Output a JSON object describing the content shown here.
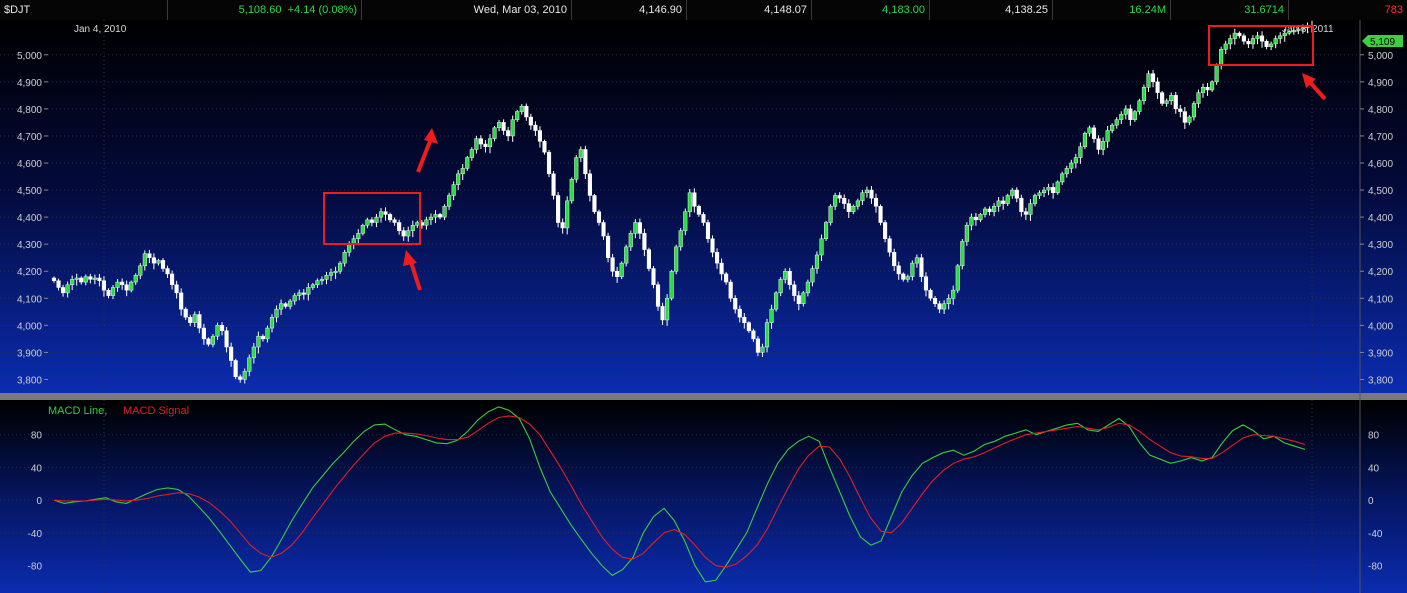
{
  "header": {
    "symbol": "$DJT",
    "last": "5,108.60",
    "change": "+4.14 (0.08%)",
    "date": "Wed, Mar 03, 2010",
    "open": "4,146.90",
    "close_prev": "4,148.07",
    "high": "4,183.00",
    "low": "4,138.25",
    "volume": "16.24M",
    "stat": "31.6714",
    "stat2": "783"
  },
  "price_panel": {
    "start_date": "Jan 4, 2010",
    "end_date": "Jan 3, 2011",
    "last_price_tag": "5,109"
  },
  "macd_panel": {
    "line_label": "MACD Line,",
    "signal_label": "MACD Signal"
  },
  "colors": {
    "up_candle": "#2fd84a",
    "down_candle": "#ffffff",
    "macd_line": "#3ccc3c",
    "macd_signal": "#e02020",
    "annotation": "#ee1c1c",
    "background_top": "#000000",
    "background_bottom": "#0a2cb0"
  },
  "chart_data": [
    {
      "type": "candlestick",
      "title": "$DJT",
      "ylim": [
        3750,
        5110
      ],
      "y_ticks": [
        3800,
        3900,
        4000,
        4100,
        4200,
        4300,
        4400,
        4500,
        4600,
        4700,
        4800,
        4900,
        5000
      ],
      "y_tick_labels": [
        "3,800",
        "3,900",
        "4,000",
        "4,100",
        "4,200",
        "4,300",
        "4,400",
        "4,500",
        "4,600",
        "4,700",
        "4,800",
        "4,900",
        "5,000"
      ],
      "x_range": [
        "Jan 4, 2010",
        "Jan 3, 2011"
      ],
      "closes": [
        4165,
        4140,
        4120,
        4150,
        4170,
        4175,
        4160,
        4180,
        4170,
        4175,
        4165,
        4130,
        4110,
        4140,
        4160,
        4150,
        4130,
        4160,
        4185,
        4220,
        4265,
        4250,
        4230,
        4240,
        4210,
        4190,
        4150,
        4120,
        4060,
        4030,
        4010,
        4040,
        3990,
        3950,
        3930,
        3960,
        4000,
        3980,
        3920,
        3870,
        3810,
        3800,
        3830,
        3880,
        3920,
        3960,
        3950,
        3990,
        4030,
        4060,
        4080,
        4070,
        4090,
        4110,
        4120,
        4115,
        4140,
        4150,
        4165,
        4170,
        4185,
        4195,
        4200,
        4230,
        4270,
        4300,
        4320,
        4340,
        4370,
        4390,
        4380,
        4400,
        4420,
        4410,
        4390,
        4380,
        4350,
        4330,
        4350,
        4370,
        4380,
        4370,
        4390,
        4400,
        4410,
        4400,
        4440,
        4480,
        4520,
        4560,
        4580,
        4620,
        4650,
        4690,
        4670,
        4660,
        4690,
        4730,
        4750,
        4720,
        4700,
        4760,
        4790,
        4810,
        4770,
        4740,
        4720,
        4680,
        4640,
        4560,
        4480,
        4380,
        4360,
        4460,
        4540,
        4620,
        4650,
        4560,
        4480,
        4420,
        4380,
        4330,
        4250,
        4200,
        4180,
        4230,
        4290,
        4340,
        4380,
        4340,
        4280,
        4210,
        4150,
        4070,
        4020,
        4100,
        4200,
        4290,
        4350,
        4420,
        4490,
        4440,
        4410,
        4380,
        4320,
        4270,
        4230,
        4190,
        4160,
        4100,
        4060,
        4030,
        4010,
        3980,
        3950,
        3900,
        3920,
        4010,
        4060,
        4120,
        4170,
        4200,
        4150,
        4110,
        4080,
        4120,
        4160,
        4210,
        4260,
        4320,
        4380,
        4440,
        4480,
        4470,
        4450,
        4420,
        4440,
        4460,
        4490,
        4500,
        4470,
        4440,
        4380,
        4320,
        4270,
        4220,
        4190,
        4170,
        4180,
        4230,
        4250,
        4180,
        4130,
        4100,
        4080,
        4060,
        4080,
        4100,
        4130,
        4220,
        4310,
        4370,
        4400,
        4390,
        4410,
        4430,
        4420,
        4440,
        4460,
        4450,
        4480,
        4500,
        4470,
        4420,
        4410,
        4450,
        4480,
        4490,
        4500,
        4510,
        4490,
        4530,
        4560,
        4580,
        4600,
        4620,
        4660,
        4710,
        4730,
        4690,
        4650,
        4680,
        4720,
        4740,
        4760,
        4780,
        4800,
        4760,
        4790,
        4830,
        4880,
        4930,
        4900,
        4860,
        4820,
        4830,
        4850,
        4800,
        4790,
        4750,
        4770,
        4820,
        4860,
        4880,
        4870,
        4900,
        4960,
        5020,
        5040,
        5060,
        5080,
        5070,
        5050,
        5040,
        5060,
        5070,
        5050,
        5030,
        5040,
        5060,
        5070,
        5080,
        5085,
        5090,
        5095,
        5100,
        5105,
        5109
      ]
    },
    {
      "type": "line",
      "title": "MACD",
      "ylim": [
        -105,
        120
      ],
      "y_ticks": [
        -80,
        -40,
        0,
        40,
        80
      ],
      "y_tick_labels": [
        "-80",
        "-40",
        "0",
        "40",
        "80"
      ],
      "series": [
        {
          "name": "MACD Line",
          "values": [
            0,
            -4,
            -2,
            -1,
            1,
            3,
            -2,
            -4,
            2,
            8,
            13,
            15,
            13,
            5,
            -8,
            -22,
            -38,
            -55,
            -72,
            -88,
            -86,
            -70,
            -48,
            -25,
            -5,
            15,
            30,
            45,
            58,
            72,
            84,
            92,
            93,
            86,
            80,
            78,
            74,
            70,
            69,
            73,
            84,
            98,
            108,
            114,
            110,
            100,
            75,
            40,
            10,
            -10,
            -30,
            -48,
            -65,
            -80,
            -92,
            -85,
            -70,
            -40,
            -20,
            -10,
            -25,
            -50,
            -80,
            -100,
            -98,
            -80,
            -60,
            -40,
            -10,
            20,
            45,
            62,
            72,
            78,
            72,
            40,
            10,
            -20,
            -45,
            -55,
            -50,
            -20,
            10,
            30,
            45,
            52,
            58,
            61,
            55,
            60,
            68,
            72,
            78,
            82,
            86,
            80,
            84,
            88,
            92,
            94,
            86,
            84,
            92,
            100,
            90,
            70,
            55,
            50,
            45,
            48,
            52,
            48,
            52,
            70,
            85,
            92,
            85,
            75,
            78,
            70,
            66,
            62
          ]
        },
        {
          "name": "MACD Signal",
          "values": [
            0,
            -1,
            -1,
            -1,
            0,
            1,
            0,
            -1,
            0,
            2,
            5,
            7,
            9,
            8,
            4,
            -3,
            -13,
            -25,
            -40,
            -55,
            -65,
            -70,
            -65,
            -55,
            -40,
            -22,
            -5,
            12,
            28,
            43,
            57,
            70,
            78,
            82,
            82,
            81,
            79,
            76,
            74,
            74,
            77,
            85,
            94,
            101,
            103,
            101,
            93,
            80,
            60,
            40,
            18,
            -5,
            -25,
            -45,
            -60,
            -70,
            -72,
            -65,
            -52,
            -40,
            -36,
            -42,
            -55,
            -70,
            -80,
            -82,
            -78,
            -68,
            -55,
            -35,
            -10,
            15,
            38,
            55,
            66,
            65,
            50,
            28,
            2,
            -22,
            -38,
            -40,
            -28,
            -10,
            8,
            24,
            36,
            45,
            50,
            53,
            58,
            64,
            70,
            75,
            80,
            82,
            84,
            86,
            88,
            90,
            88,
            86,
            89,
            94,
            92,
            84,
            74,
            66,
            58,
            54,
            53,
            51,
            51,
            58,
            67,
            76,
            80,
            79,
            78,
            75,
            72,
            68
          ]
        }
      ]
    }
  ]
}
